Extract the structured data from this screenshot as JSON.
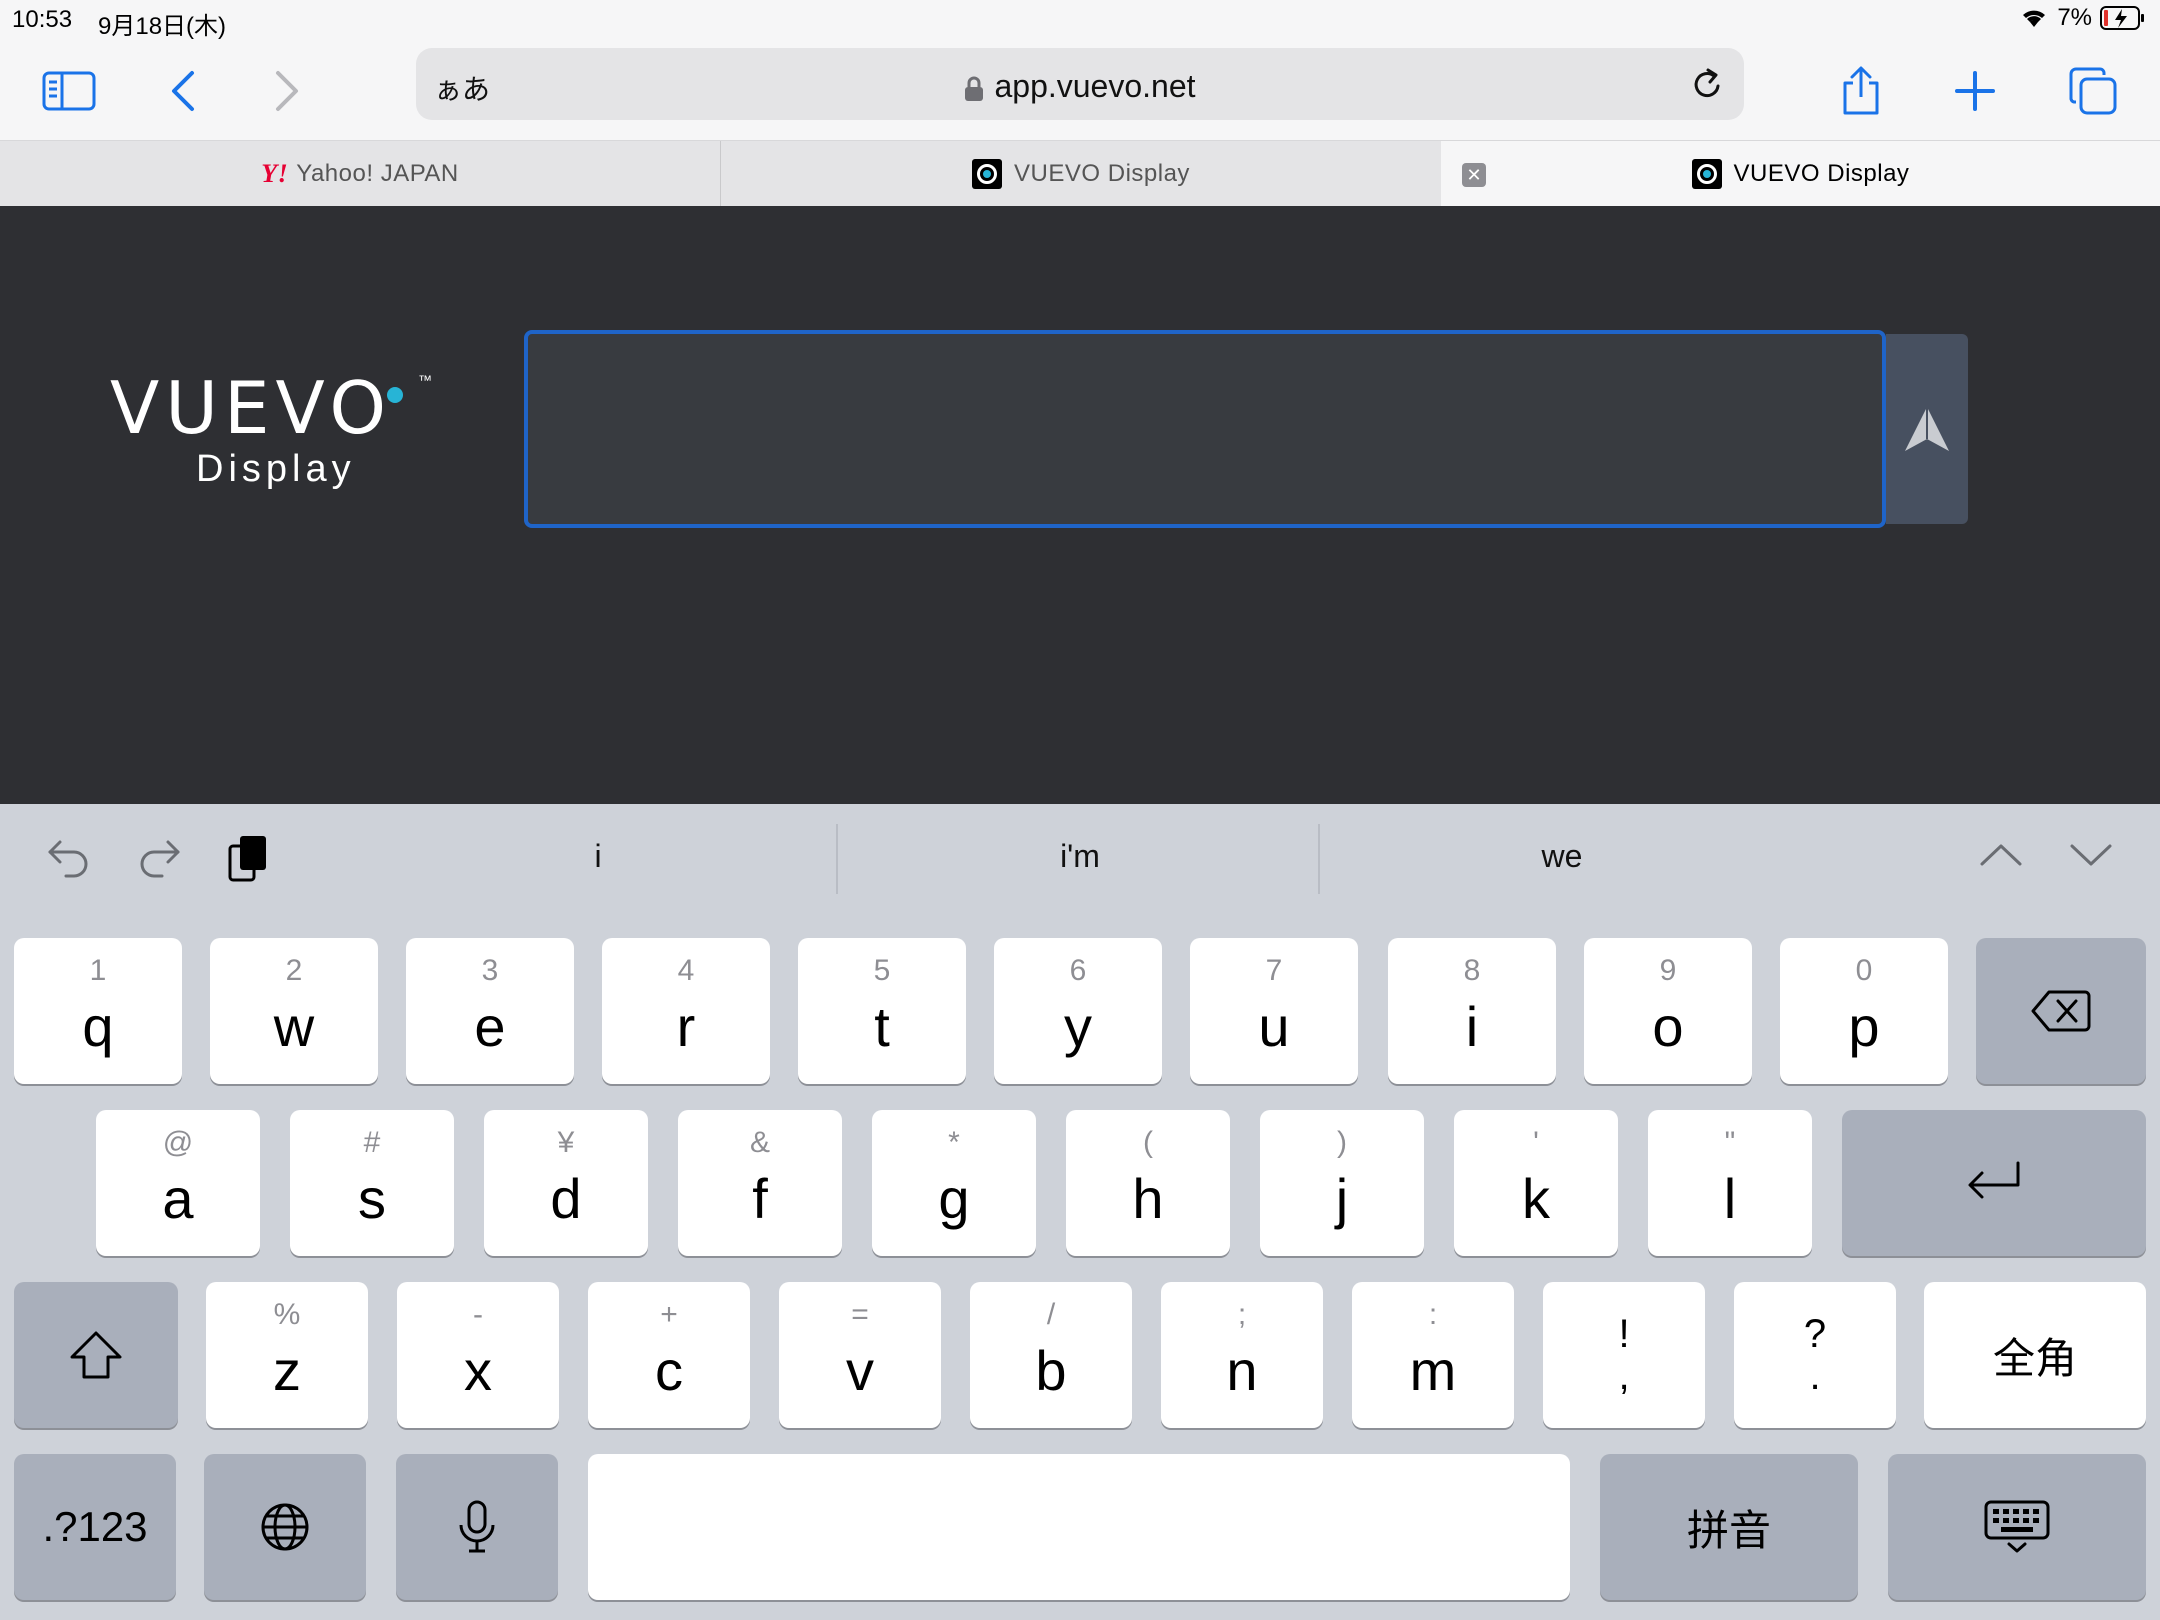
{
  "status": {
    "time": "10:53",
    "date": "9月18日(木)",
    "battery": "7%"
  },
  "toolbar": {
    "address_prefix": "ぁあ",
    "url": "app.vuevo.net"
  },
  "tabs": [
    {
      "title": "Yahoo! JAPAN",
      "favicon_text": "Y!"
    },
    {
      "title": "VUEVO Display"
    },
    {
      "title": "VUEVO Display"
    }
  ],
  "page": {
    "logo_word": "VUEVO",
    "logo_tm": "™",
    "logo_sub": "Display",
    "message_value": ""
  },
  "keyboard": {
    "suggestions": [
      "i",
      "i'm",
      "we"
    ],
    "row1": [
      {
        "hint": "1",
        "key": "q"
      },
      {
        "hint": "2",
        "key": "w"
      },
      {
        "hint": "3",
        "key": "e"
      },
      {
        "hint": "4",
        "key": "r"
      },
      {
        "hint": "5",
        "key": "t"
      },
      {
        "hint": "6",
        "key": "y"
      },
      {
        "hint": "7",
        "key": "u"
      },
      {
        "hint": "8",
        "key": "i"
      },
      {
        "hint": "9",
        "key": "o"
      },
      {
        "hint": "0",
        "key": "p"
      }
    ],
    "row2": [
      {
        "hint": "@",
        "key": "a"
      },
      {
        "hint": "#",
        "key": "s"
      },
      {
        "hint": "¥",
        "key": "d"
      },
      {
        "hint": "&",
        "key": "f"
      },
      {
        "hint": "*",
        "key": "g"
      },
      {
        "hint": "(",
        "key": "h"
      },
      {
        "hint": ")",
        "key": "j"
      },
      {
        "hint": "'",
        "key": "k"
      },
      {
        "hint": "\"",
        "key": "l"
      }
    ],
    "row3": [
      {
        "hint": "%",
        "key": "z"
      },
      {
        "hint": "-",
        "key": "x"
      },
      {
        "hint": "+",
        "key": "c"
      },
      {
        "hint": "=",
        "key": "v"
      },
      {
        "hint": "/",
        "key": "b"
      },
      {
        "hint": ";",
        "key": "n"
      },
      {
        "hint": ":",
        "key": "m"
      }
    ],
    "exclaim_top": "!",
    "exclaim_bottom": ",",
    "question_top": "?",
    "question_bottom": ".",
    "fullwidth": "全角",
    "numbers": ".?123",
    "pinyin": "拼音"
  }
}
